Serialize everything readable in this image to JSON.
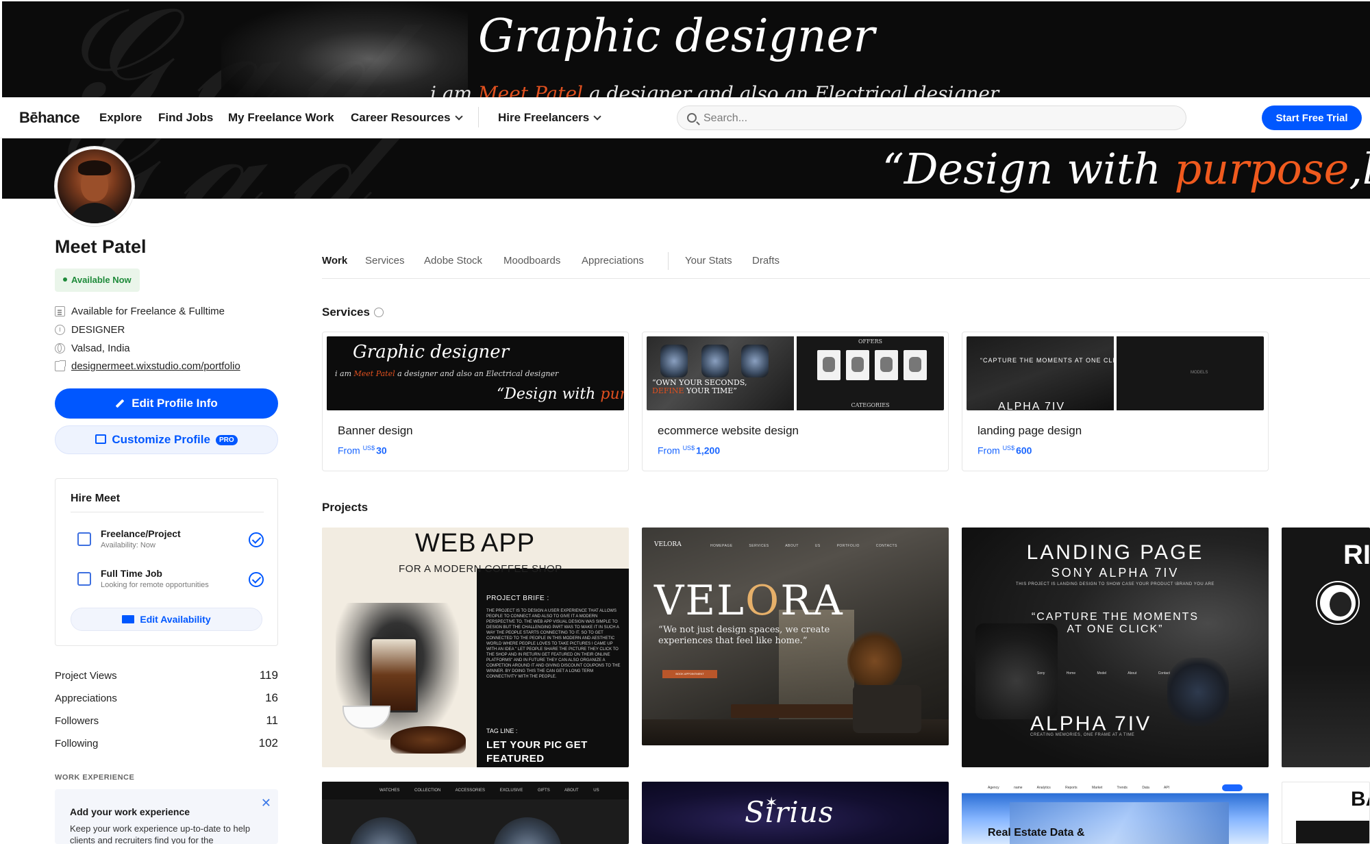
{
  "top_banner": {
    "title": "Graphic designer",
    "subtitle_pre": "i am",
    "subtitle_name": "Meet Patel",
    "subtitle_post": "a designer and also an Electrical designer"
  },
  "nav": {
    "logo": "Bēhance",
    "items": [
      "Explore",
      "Find Jobs",
      "My Freelance Work",
      "Career Resources",
      "Hire Freelancers"
    ],
    "search_placeholder": "Search...",
    "trial_label": "Start Free Trial"
  },
  "second_banner": {
    "quote_pre": "“Design with",
    "quote_hl": "purpose",
    "quote_post": ",lead"
  },
  "profile": {
    "name": "Meet Patel",
    "availability": "Available Now",
    "details": [
      {
        "icon": "document-icon",
        "text": "Available for Freelance & Fulltime"
      },
      {
        "icon": "info-icon",
        "text": "DESIGNER"
      },
      {
        "icon": "globe-icon",
        "text": "Valsad, India"
      },
      {
        "icon": "external-link-icon",
        "text": "designermeet.wixstudio.com/portfolio"
      }
    ],
    "edit_label": "Edit Profile Info",
    "customize_label": "Customize Profile",
    "pro_label": "PRO"
  },
  "hire": {
    "title": "Hire Meet",
    "options": [
      {
        "name": "Freelance/Project",
        "sub": "Availability: Now"
      },
      {
        "name": "Full Time Job",
        "sub": "Looking for remote opportunities"
      }
    ],
    "edit_label": "Edit Availability"
  },
  "stats": [
    {
      "label": "Project Views",
      "value": "119"
    },
    {
      "label": "Appreciations",
      "value": "16"
    },
    {
      "label": "Followers",
      "value": "11"
    },
    {
      "label": "Following",
      "value": "102"
    }
  ],
  "work_experience": {
    "label": "WORK EXPERIENCE",
    "title": "Add your work experience",
    "desc": "Keep your work experience up-to-date to help clients and recruiters find you for the"
  },
  "tabs": [
    "Work",
    "Services",
    "Adobe Stock",
    "Moodboards",
    "Appreciations",
    "Your Stats",
    "Drafts"
  ],
  "services": {
    "title": "Services",
    "items": [
      {
        "name": "Banner design",
        "from": "From",
        "cur": "US$",
        "amount": "30"
      },
      {
        "name": "ecommerce website design",
        "from": "From",
        "cur": "US$",
        "amount": "1,200"
      },
      {
        "name": "landing page design",
        "from": "From",
        "cur": "US$",
        "amount": "600"
      }
    ],
    "thumb_text": {
      "banner_title": "Graphic designer",
      "banner_sub_pre": "i am",
      "banner_sub_name": "Meet Patel",
      "banner_sub_post": "a designer and also an Electrical designer",
      "banner_quote_pre": "“Design with",
      "banner_quote_hl": "purp",
      "ecom_cap1": "“OWN YOUR SECONDS,",
      "ecom_cap2_hl": "DEFINE",
      "ecom_cap2_post": "YOUR TIME”",
      "ecom_offers": "OFFERS",
      "ecom_categories": "CATEGORIES",
      "land_cap": "“CAPTURE THE MOMENTS AT ONE CLICK”",
      "land_big": "ALPHA 7IV",
      "land_models": "MODELS"
    }
  },
  "projects": {
    "title": "Projects",
    "webapp": {
      "web": "WEB",
      "app": "APP",
      "sub": "FOR A MODERN COFFEE SHOP",
      "brief_title": "PROJECT BRIFE :",
      "brief": "THE PROJECT IS TO DESIGN A USER EXPERIENCE THAT ALLOWS PEOPLE TO CONNECT AND ALSO TO GIVE IT A MODERN PERSPECTIVE TO. THE WEB APP VISUAL DESIGN WAS SIMPLE TO DESIGN BUT THE CHALLENGING PART WAS TO MAKE IT IN SUCH A WAY THE PEOPLE STARTS CONNECTING TO IT. SO TO GET CONNECTED TO THE PEOPLE IN THIS MODERN AND AESTHETIC WORLD WHERE PEOPLE LOVES TO TAKE PICTURES I CAME UP WITH AN IDEA \" LET PEOPLE SHARE THE PICTURE THEY CLICK TO THE SHOP AND IN RETURN GET FEATURED ON THEIR ONLINE PLATFORMS\" AND IN FUTURE THEY CAN ALSO ORGANIZE A COMPETION AROUND IT AND GIVING DISCOUNT COUPONS TO THE WINNER. BY DOING THIS THE CAN GET A LONG TERM CONNECTIVITY WITH THE PEOPLE.",
      "tag": "TAG LINE :",
      "tagline1": "LET YOUR PIC GET",
      "tagline2": "FEATURED"
    },
    "velora": {
      "logo": "VELORA",
      "links": "HOMEPAGE SERVICES ABOUT US PORTFOLIO CONTACTS",
      "big_pre": "VEL",
      "big_o": "O",
      "big_post": "RA",
      "tag1": "“We not just design spaces, we create",
      "tag2": "experiences that feel like home.”",
      "cta": "BOOK APPOINTMENT"
    },
    "landing": {
      "t1": "LANDING PAGE",
      "t2": "SONY ALPHA 7IV",
      "t3": "THIS PROJECT IS LANDING DESIGN TO SHOW CASE YOUR PRODUCT \\BRAND YOU ARE",
      "t4a": "“CAPTURE THE MOMENTS",
      "t4b": "AT ONE CLICK”",
      "links": "Sony Home Model About Contact",
      "t5": "ALPHA 7IV",
      "t6": "CREATING MEMORIES, ONE FRAME AT A TIME"
    },
    "cut4": {
      "t": "RI"
    },
    "watch2": {
      "links": "WATCHES COLLECTION ACCESSORIES EXCLUSIVE GIFTS ABOUT US"
    },
    "sirius": {
      "t": "Sirius"
    },
    "realestate": {
      "top": "Agency name Analytics Reports Market Trends Data API",
      "t": "Real Estate Data &"
    },
    "cut8": {
      "t": "BA"
    }
  }
}
